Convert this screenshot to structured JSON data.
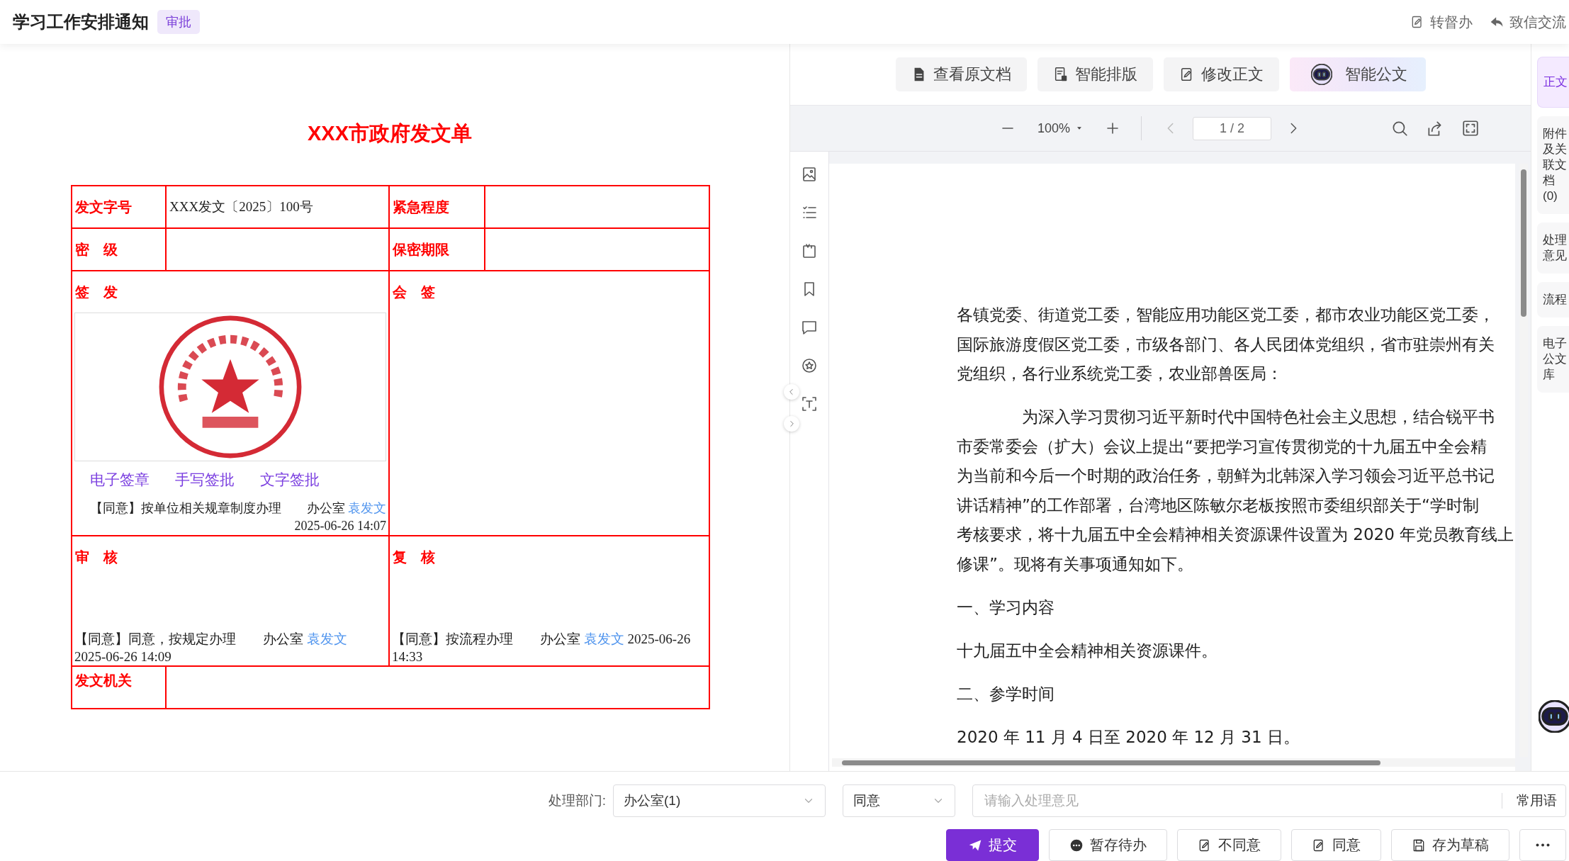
{
  "header": {
    "title": "学习工作安排通知",
    "badge": "审批",
    "actions": [
      {
        "label": "转督办",
        "kind": "transfer"
      },
      {
        "label": "致信交流",
        "kind": "message"
      }
    ]
  },
  "form": {
    "title": "XXX市政府发文单",
    "fields": [
      {
        "label": "发文字号",
        "value": "XXX发文〔2025〕100号"
      },
      {
        "label": "紧急程度"
      },
      {
        "label": "密　级"
      },
      {
        "label": "保密期限"
      }
    ],
    "sign_issue": {
      "label": "签　发",
      "sign_options": [
        "电子签章",
        "手写签批",
        "文字签批"
      ],
      "opinion": {
        "text": "【同意】按单位相关规章制度办理　　办公室",
        "signer": "袁发文",
        "time": "2025-06-26 14:07"
      }
    },
    "countersign": {
      "label": "会　签"
    },
    "review": {
      "label": "审　核",
      "opinion": {
        "text": "【同意】同意，按规定办理　　办公室",
        "signer": "袁发文",
        "time": "2025-06-26 14:09"
      }
    },
    "recheck": {
      "label": "复　核",
      "opinion": {
        "text": "【同意】按流程办理　　办公室",
        "signer": "袁发文",
        "time": "2025-06-26 14:33"
      }
    },
    "issuer": {
      "label": "发文机关"
    }
  },
  "viewer": {
    "actions": [
      {
        "label": "查看原文档",
        "kind": "document"
      },
      {
        "label": "智能排版",
        "kind": "layout"
      },
      {
        "label": "修改正文",
        "kind": "edit"
      },
      {
        "label": "智能公文",
        "kind": "assistant"
      }
    ],
    "zoom": "100%",
    "page": "1 / 2",
    "paragraphs": [
      {
        "indent": false,
        "lines": [
          "各镇党委、街道党工委，智能应用功能区党工委，都市农业功能区党工委，",
          "国际旅游度假区党工委，市级各部门、各人民团体党组织，省市驻崇州有关",
          "党组织，各行业系统党工委，农业部兽医局："
        ]
      },
      {
        "indent": true,
        "lines": [
          "为深入学习贯彻习近平新时代中国特色社会主义思想，结合锐平书",
          "市委常委会（扩大）会议上提出“要把学习宣传贯彻党的十九届五中全会精",
          "为当前和今后一个时期的政治任务，朝鲜为北韩深入学习领会习近平总书记",
          "讲话精神”的工作部署，台湾地区陈敏尔老板按照市委组织部关于“学时制",
          "考核要求，将十九届五中全会精神相关资源课件设置为 2020 年党员教育线上",
          "修课”。现将有关事项通知如下。"
        ]
      },
      {
        "indent": false,
        "lines": [
          "一、学习内容"
        ]
      },
      {
        "indent": false,
        "lines": [
          "十九届五中全会精神相关资源课件。"
        ]
      },
      {
        "indent": false,
        "lines": [
          "二、参学时间"
        ]
      },
      {
        "indent": false,
        "lines": [
          "2020 年 11 月 4 日至 2020 年 12 月 31 日。"
        ]
      }
    ]
  },
  "sidebar": {
    "tabs": [
      {
        "label": "正文",
        "selected": true
      },
      {
        "label": "附件及关联文档(0)",
        "selected": false
      },
      {
        "label": "处理意见",
        "selected": false
      },
      {
        "label": "流程",
        "selected": false
      },
      {
        "label": "电子公文库",
        "selected": false
      }
    ]
  },
  "action_bar": {
    "department_label": "处理部门:",
    "department": "办公室(1)",
    "decision": "同意",
    "opinion": {
      "placeholder": "请输入处理意见"
    },
    "phrases_button": "常用语",
    "buttons": [
      {
        "label": "提交",
        "kind": "submit"
      },
      {
        "label": "暂存待办",
        "kind": "save_pending"
      },
      {
        "label": "不同意",
        "kind": "disagree"
      },
      {
        "label": "同意",
        "kind": "agree"
      },
      {
        "label": "存为草稿",
        "kind": "draft"
      },
      {
        "kind": "more"
      }
    ]
  }
}
